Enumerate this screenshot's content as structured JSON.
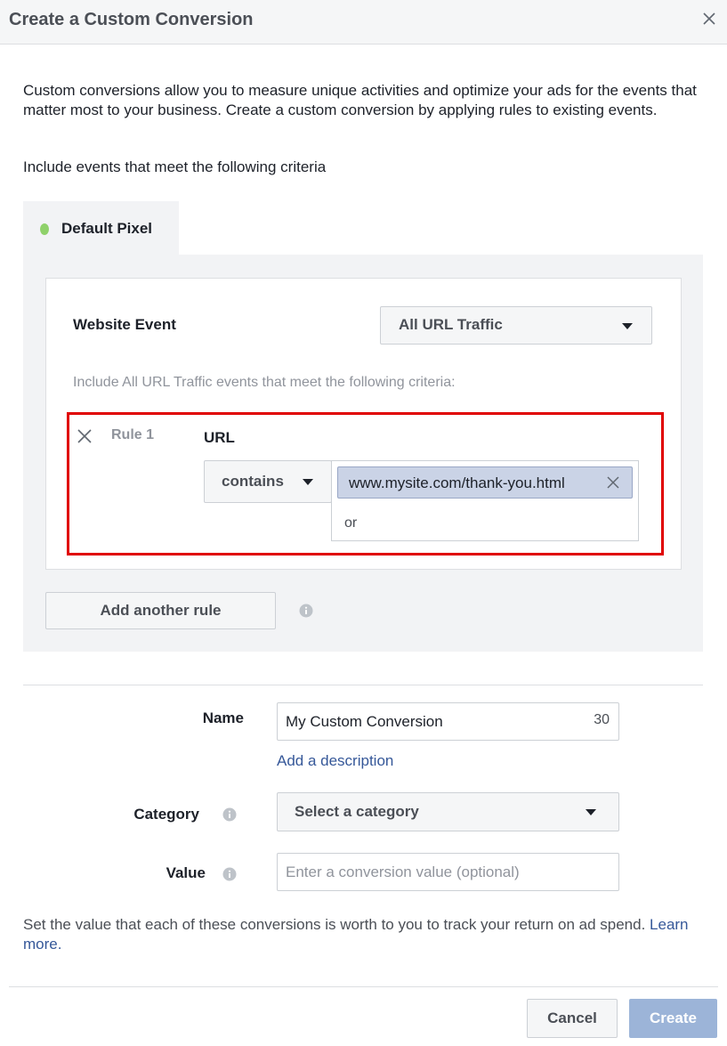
{
  "dialog": {
    "title": "Create a Custom Conversion",
    "intro": "Custom conversions allow you to measure unique activities and optimize your ads for the events that matter most to your business. Create a custom conversion by applying rules to existing events.",
    "criteria_label": "Include events that meet the following criteria"
  },
  "pixel": {
    "tab_label": "Default Pixel",
    "status_color": "#8fd16a"
  },
  "event": {
    "label": "Website Event",
    "selected": "All URL Traffic",
    "include_text": "Include All URL Traffic events that meet the following criteria:"
  },
  "rule": {
    "label": "Rule 1",
    "field": "URL",
    "operator": "contains",
    "token_value": "www.mysite.com/thank-you.html",
    "or_placeholder": "or",
    "highlight_color": "#e00000"
  },
  "add_rule": {
    "label": "Add another rule"
  },
  "form": {
    "name_label": "Name",
    "name_value": "My Custom Conversion",
    "name_remaining": "30",
    "add_description": "Add a description",
    "category_label": "Category",
    "category_placeholder": "Select a category",
    "value_label": "Value",
    "value_placeholder": "Enter a conversion value (optional)",
    "value_note": "Set the value that each of these conversions is worth to you to track your return on ad spend.",
    "learn_more": "Learn more."
  },
  "footer": {
    "cancel": "Cancel",
    "create": "Create"
  }
}
